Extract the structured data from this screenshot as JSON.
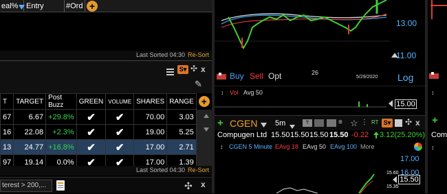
{
  "top_table": {
    "columns": [
      "eal%",
      "Entry",
      "#Ord"
    ],
    "add_symbol": "+",
    "last_sorted": "Last Sorted 04:30",
    "resort": "Re-Sort"
  },
  "grid": {
    "columns": [
      "T",
      "TARGET",
      "Post Buzz",
      "GREEN",
      "VOLUME",
      "SHARES",
      "RANGE"
    ],
    "rows": [
      {
        "t": "67",
        "target": "6.67",
        "post_buzz": "+29.8%",
        "green": "✔",
        "volume": "✔",
        "shares": "70.00",
        "range": "3.03"
      },
      {
        "t": "16",
        "target": "22.08",
        "post_buzz": "+2.3%",
        "green": "✔",
        "volume": "✔",
        "shares": "19.00",
        "range": "5.25"
      },
      {
        "t": "13",
        "target": "24.77",
        "post_buzz": "+16.8%",
        "green": "✔",
        "volume": "✔",
        "shares": "17.00",
        "range": "2.71"
      },
      {
        "t": "97",
        "target": "19.14",
        "post_buzz": "0.0%",
        "green": "✔",
        "volume": "✔",
        "shares": "17.00",
        "range": "1.39"
      }
    ],
    "last_sorted": "Last Sorted 04:30",
    "resort": "Re-Sort",
    "filter_text": "terest > 200,..."
  },
  "chart_top": {
    "price_labels": [
      "13.00",
      "11.00"
    ],
    "buy": "Buy",
    "sell": "Sell",
    "opt": "Opt",
    "center_label": "26",
    "date_label": "5/29/2020",
    "log": "Log",
    "vol_label": "Vol",
    "avg_label": "Avg 50",
    "volume_price": "15.00"
  },
  "chart_bottom": {
    "symbol": "CGEN",
    "interval": "5m",
    "company": "Compugen Ltd",
    "quote": [
      "15.50",
      "15.50",
      "15.50",
      "15.50"
    ],
    "change": "-0.22",
    "day_change": "3.12(25.20%)",
    "study_title": "CGEN 5 Minute",
    "eavg18": "EAvg 18",
    "eavg50": "EAvg 50",
    "eavg100": "EAvg 100",
    "more": "More",
    "prices": [
      "17.00",
      "16.00",
      "15.50",
      "15.60",
      "15.35"
    ]
  },
  "right_partial": {
    "company_partial": "Com"
  }
}
